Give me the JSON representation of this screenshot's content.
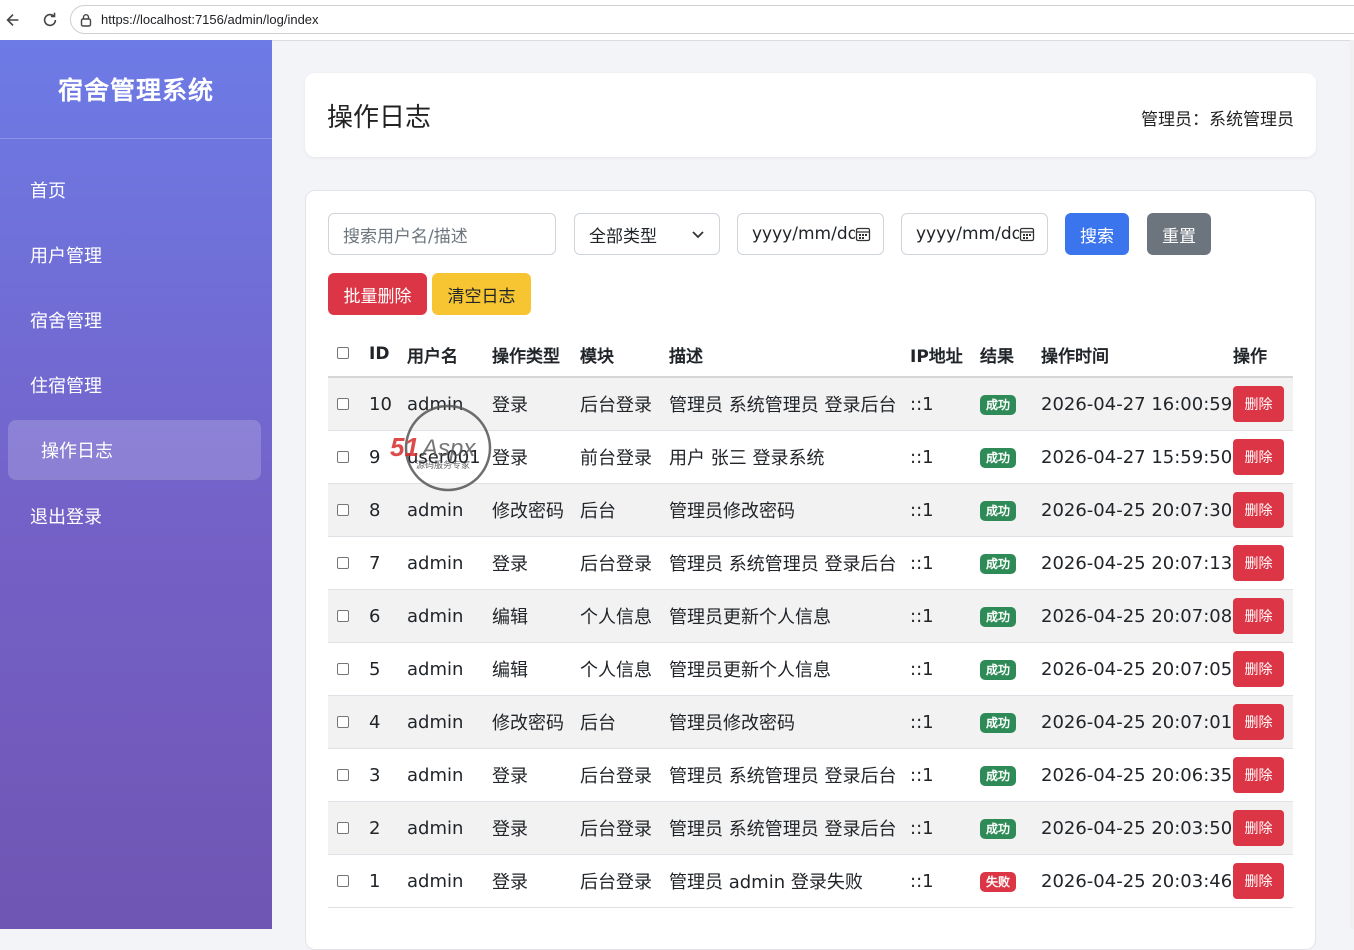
{
  "browser": {
    "url": "https://localhost:7156/admin/log/index"
  },
  "sidebar": {
    "brand": "宿舍管理系统",
    "items": [
      {
        "label": "首页"
      },
      {
        "label": "用户管理"
      },
      {
        "label": "宿舍管理"
      },
      {
        "label": "住宿管理"
      },
      {
        "label": "操作日志",
        "active": true
      },
      {
        "label": "退出登录"
      }
    ]
  },
  "header": {
    "title": "操作日志",
    "admin": "管理员：系统管理员"
  },
  "filters": {
    "search_placeholder": "搜索用户名/描述",
    "type_selected": "全部类型",
    "date_start_placeholder": "yyyy/mm/dd",
    "date_end_placeholder": "yyyy/mm/dd",
    "search_label": "搜索",
    "reset_label": "重置",
    "batch_delete_label": "批量删除",
    "clear_label": "清空日志"
  },
  "table": {
    "columns": [
      "ID",
      "用户名",
      "操作类型",
      "模块",
      "描述",
      "IP地址",
      "结果",
      "操作时间",
      "操作"
    ],
    "delete_label": "删除",
    "rows": [
      {
        "id": "10",
        "user": "admin",
        "type": "登录",
        "module": "后台登录",
        "desc": "管理员 系统管理员 登录后台",
        "ip": "::1",
        "result": "成功",
        "ok": true,
        "time": "2026-04-27 16:00:59"
      },
      {
        "id": "9",
        "user": "user001",
        "type": "登录",
        "module": "前台登录",
        "desc": "用户 张三 登录系统",
        "ip": "::1",
        "result": "成功",
        "ok": true,
        "time": "2026-04-27 15:59:50"
      },
      {
        "id": "8",
        "user": "admin",
        "type": "修改密码",
        "module": "后台",
        "desc": "管理员修改密码",
        "ip": "::1",
        "result": "成功",
        "ok": true,
        "time": "2026-04-25 20:07:30"
      },
      {
        "id": "7",
        "user": "admin",
        "type": "登录",
        "module": "后台登录",
        "desc": "管理员 系统管理员 登录后台",
        "ip": "::1",
        "result": "成功",
        "ok": true,
        "time": "2026-04-25 20:07:13"
      },
      {
        "id": "6",
        "user": "admin",
        "type": "编辑",
        "module": "个人信息",
        "desc": "管理员更新个人信息",
        "ip": "::1",
        "result": "成功",
        "ok": true,
        "time": "2026-04-25 20:07:08"
      },
      {
        "id": "5",
        "user": "admin",
        "type": "编辑",
        "module": "个人信息",
        "desc": "管理员更新个人信息",
        "ip": "::1",
        "result": "成功",
        "ok": true,
        "time": "2026-04-25 20:07:05"
      },
      {
        "id": "4",
        "user": "admin",
        "type": "修改密码",
        "module": "后台",
        "desc": "管理员修改密码",
        "ip": "::1",
        "result": "成功",
        "ok": true,
        "time": "2026-04-25 20:07:01"
      },
      {
        "id": "3",
        "user": "admin",
        "type": "登录",
        "module": "后台登录",
        "desc": "管理员 系统管理员 登录后台",
        "ip": "::1",
        "result": "成功",
        "ok": true,
        "time": "2026-04-25 20:06:35"
      },
      {
        "id": "2",
        "user": "admin",
        "type": "登录",
        "module": "后台登录",
        "desc": "管理员 系统管理员 登录后台",
        "ip": "::1",
        "result": "成功",
        "ok": true,
        "time": "2026-04-25 20:03:50"
      },
      {
        "id": "1",
        "user": "admin",
        "type": "登录",
        "module": "后台登录",
        "desc": "管理员 admin 登录失败",
        "ip": "::1",
        "result": "失败",
        "ok": false,
        "time": "2026-04-25 20:03:46"
      }
    ]
  },
  "watermark": {
    "brand": "51Aspx",
    "tagline": "源码服务专家"
  },
  "colors": {
    "sidebar_top": "#6d7be6",
    "sidebar_bottom": "#6f55b3",
    "primary": "#3a75ee",
    "danger": "#dc3545",
    "warning": "#f7c531",
    "success": "#2e8b57",
    "secondary": "#6c757d"
  }
}
